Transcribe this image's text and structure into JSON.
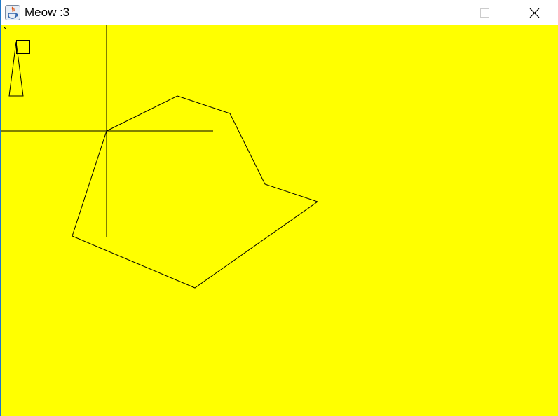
{
  "window": {
    "title": "Meow :3",
    "app_icon": "java-icon"
  },
  "title_controls": {
    "minimize_icon": "minimize-icon",
    "maximize_icon": "maximize-icon",
    "close_icon": "close-icon"
  },
  "colors": {
    "canvas_background": "#ffff00",
    "stroke": "#000000",
    "window_border": "#1e78c8",
    "maximize_disabled": "#cccccc"
  }
}
